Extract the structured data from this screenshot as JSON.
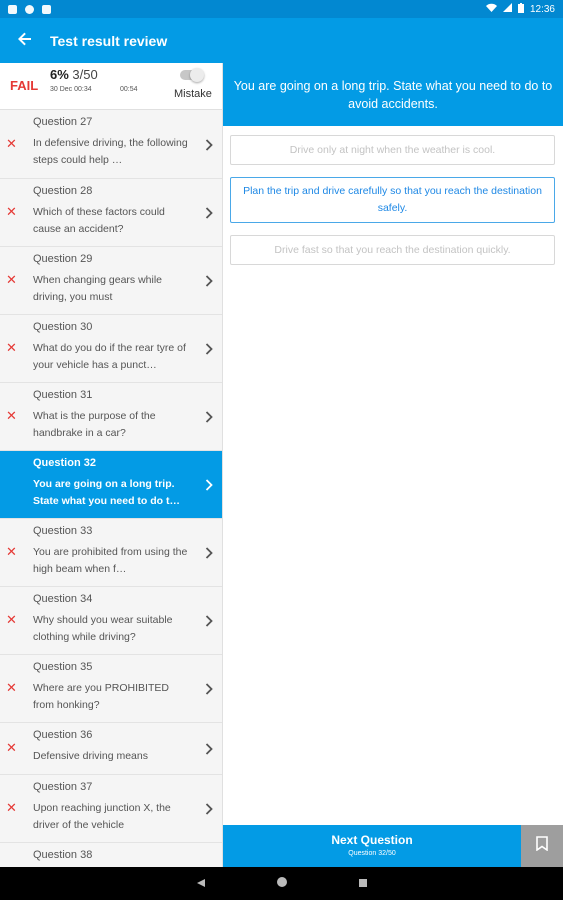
{
  "status_bar": {
    "time": "12:36"
  },
  "app_bar": {
    "title": "Test result review"
  },
  "summary": {
    "result": "FAIL",
    "percent": "6%",
    "score": "3/50",
    "date": "30 Dec 00:34",
    "elapsed": "00:54",
    "mistake_label": "Mistake"
  },
  "questions": [
    {
      "number": "Question 27",
      "text": "In defensive driving, the following steps could help …",
      "wrong": true
    },
    {
      "number": "Question 28",
      "text": "Which of these factors could cause an accident?",
      "wrong": true
    },
    {
      "number": "Question 29",
      "text": "When changing gears while driving, you must",
      "wrong": true
    },
    {
      "number": "Question 30",
      "text": "What do you do if the rear tyre of your vehicle has a punct…",
      "wrong": true
    },
    {
      "number": "Question 31",
      "text": "What is the purpose of the handbrake in a car?",
      "wrong": true
    },
    {
      "number": "Question 32",
      "text": "You are going on a long trip. State what you need to do t…",
      "wrong": false,
      "active": true
    },
    {
      "number": "Question 33",
      "text": "You are prohibited from using the high beam when f…",
      "wrong": true
    },
    {
      "number": "Question 34",
      "text": "Why should you wear suitable clothing while driving?",
      "wrong": true
    },
    {
      "number": "Question 35",
      "text": "Where are you PROHIBITED from honking?",
      "wrong": true
    },
    {
      "number": "Question 36",
      "text": "Defensive driving means",
      "wrong": true
    },
    {
      "number": "Question 37",
      "text": "Upon reaching junction X, the driver of the vehicle",
      "wrong": true
    },
    {
      "number": "Question 38",
      "text": "",
      "wrong": false
    }
  ],
  "current_question": {
    "text": "You are going on a long trip. State what you need to do to avoid accidents.",
    "options": [
      {
        "text": "Drive only at night when the weather is cool.",
        "correct": false
      },
      {
        "text": "Plan the trip and drive carefully so that you reach the destination safely.",
        "correct": true
      },
      {
        "text": "Drive fast so that you reach the destination quickly.",
        "correct": false
      }
    ]
  },
  "footer": {
    "next_label": "Next Question",
    "progress": "Question 32/50"
  },
  "colors": {
    "primary": "#039be5",
    "fail": "#e53935",
    "correct": "#1e88e5"
  }
}
